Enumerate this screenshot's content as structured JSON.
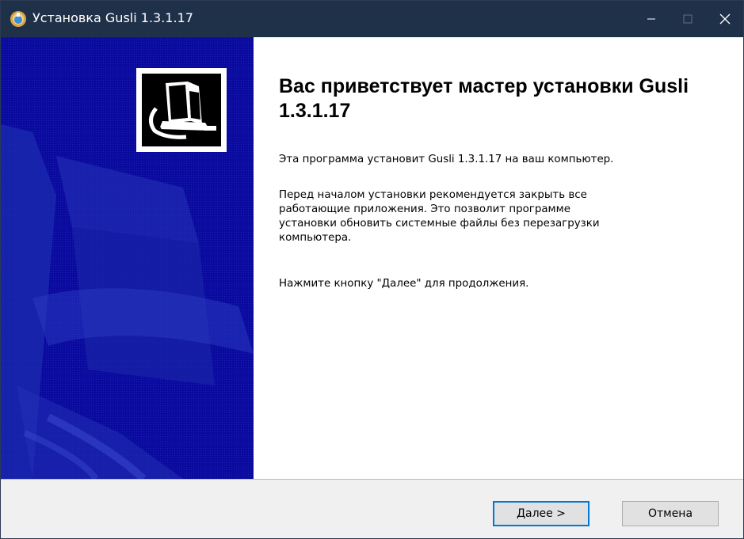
{
  "window": {
    "title": "Установка Gusli 1.3.1.17",
    "icon": "installer-app-icon",
    "controls": [
      "minimize-icon",
      "maximize-icon",
      "close-icon"
    ]
  },
  "banner": {
    "background_color": "#0a0b9e",
    "logo_icon": "computer-install-icon"
  },
  "content": {
    "heading": "Вас приветствует мастер установки Gusli 1.3.1.17",
    "paragraph1": "Эта программа установит Gusli 1.3.1.17 на ваш компьютер.",
    "paragraph2": "Перед началом установки рекомендуется закрыть все\nработающие приложения. Это позволит программе\nустановки обновить системные файлы без перезагрузки\nкомпьютера.",
    "paragraph3": "Нажмите кнопку \"Далее\" для продолжения."
  },
  "buttons": {
    "next_label": "Далее >",
    "cancel_label": "Отмена"
  },
  "colors": {
    "titlebar": "#1f3149",
    "accent": "#0078d7"
  }
}
